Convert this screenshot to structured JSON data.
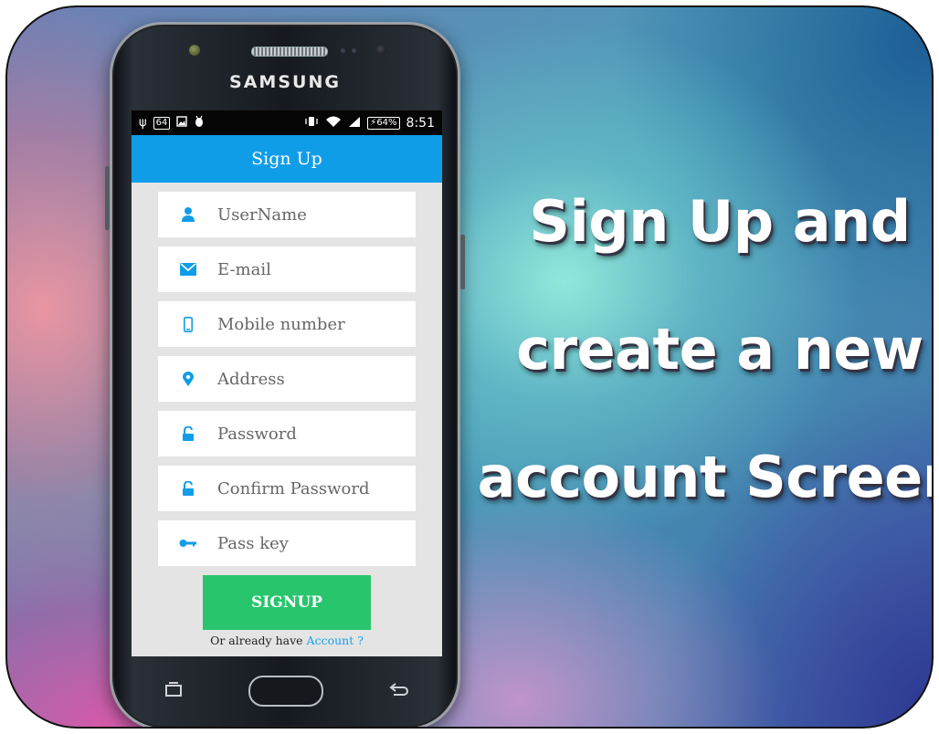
{
  "headline": {
    "line1": "Sign Up and",
    "line2": "create a new",
    "line3": "account Screen"
  },
  "phone": {
    "brand": "SAMSUNG"
  },
  "statusbar": {
    "usb": "ψ",
    "notif_badge": "64",
    "battery": "⚡64%",
    "time": "8:51"
  },
  "appbar": {
    "title": "Sign Up"
  },
  "form": {
    "fields": [
      {
        "placeholder": "UserName",
        "icon": "user-icon"
      },
      {
        "placeholder": "E-mail",
        "icon": "envelope-icon"
      },
      {
        "placeholder": "Mobile number",
        "icon": "mobile-icon"
      },
      {
        "placeholder": "Address",
        "icon": "map-marker-icon"
      },
      {
        "placeholder": "Password",
        "icon": "unlock-icon"
      },
      {
        "placeholder": "Confirm Password",
        "icon": "unlock-icon"
      },
      {
        "placeholder": "Pass key",
        "icon": "key-icon"
      }
    ],
    "submit_label": "SIGNUP",
    "already_text": "Or already have",
    "account_link": "Account ?"
  },
  "colors": {
    "appbar": "#0f9de8",
    "signup_button": "#29c56d",
    "icon": "#0f9de8"
  }
}
